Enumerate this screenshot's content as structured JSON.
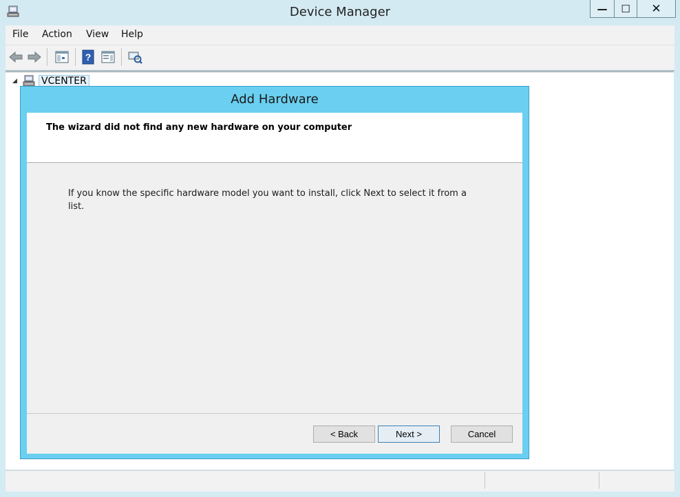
{
  "window": {
    "title": "Device Manager"
  },
  "menu": {
    "items": [
      "File",
      "Action",
      "View",
      "Help"
    ]
  },
  "tree": {
    "root_label": "VCENTER"
  },
  "dialog": {
    "title": "Add Hardware",
    "header": "The wizard did not find any new hardware on your computer",
    "body": "If you know the specific hardware model you want to install, click Next to select it from a list.",
    "buttons": {
      "back": "< Back",
      "next": "Next >",
      "cancel": "Cancel"
    }
  },
  "caption": {
    "minimize": "—",
    "maximize": "☐",
    "close": "✕"
  },
  "icons": [
    "computer-icon",
    "back-arrow-icon",
    "forward-arrow-icon",
    "show-hide-tree-icon",
    "help-icon",
    "properties-icon",
    "scan-hardware-icon",
    "expander-icon"
  ],
  "colors": {
    "titlebar": "#d3eaf2",
    "dialog_frame": "#6acff0"
  }
}
